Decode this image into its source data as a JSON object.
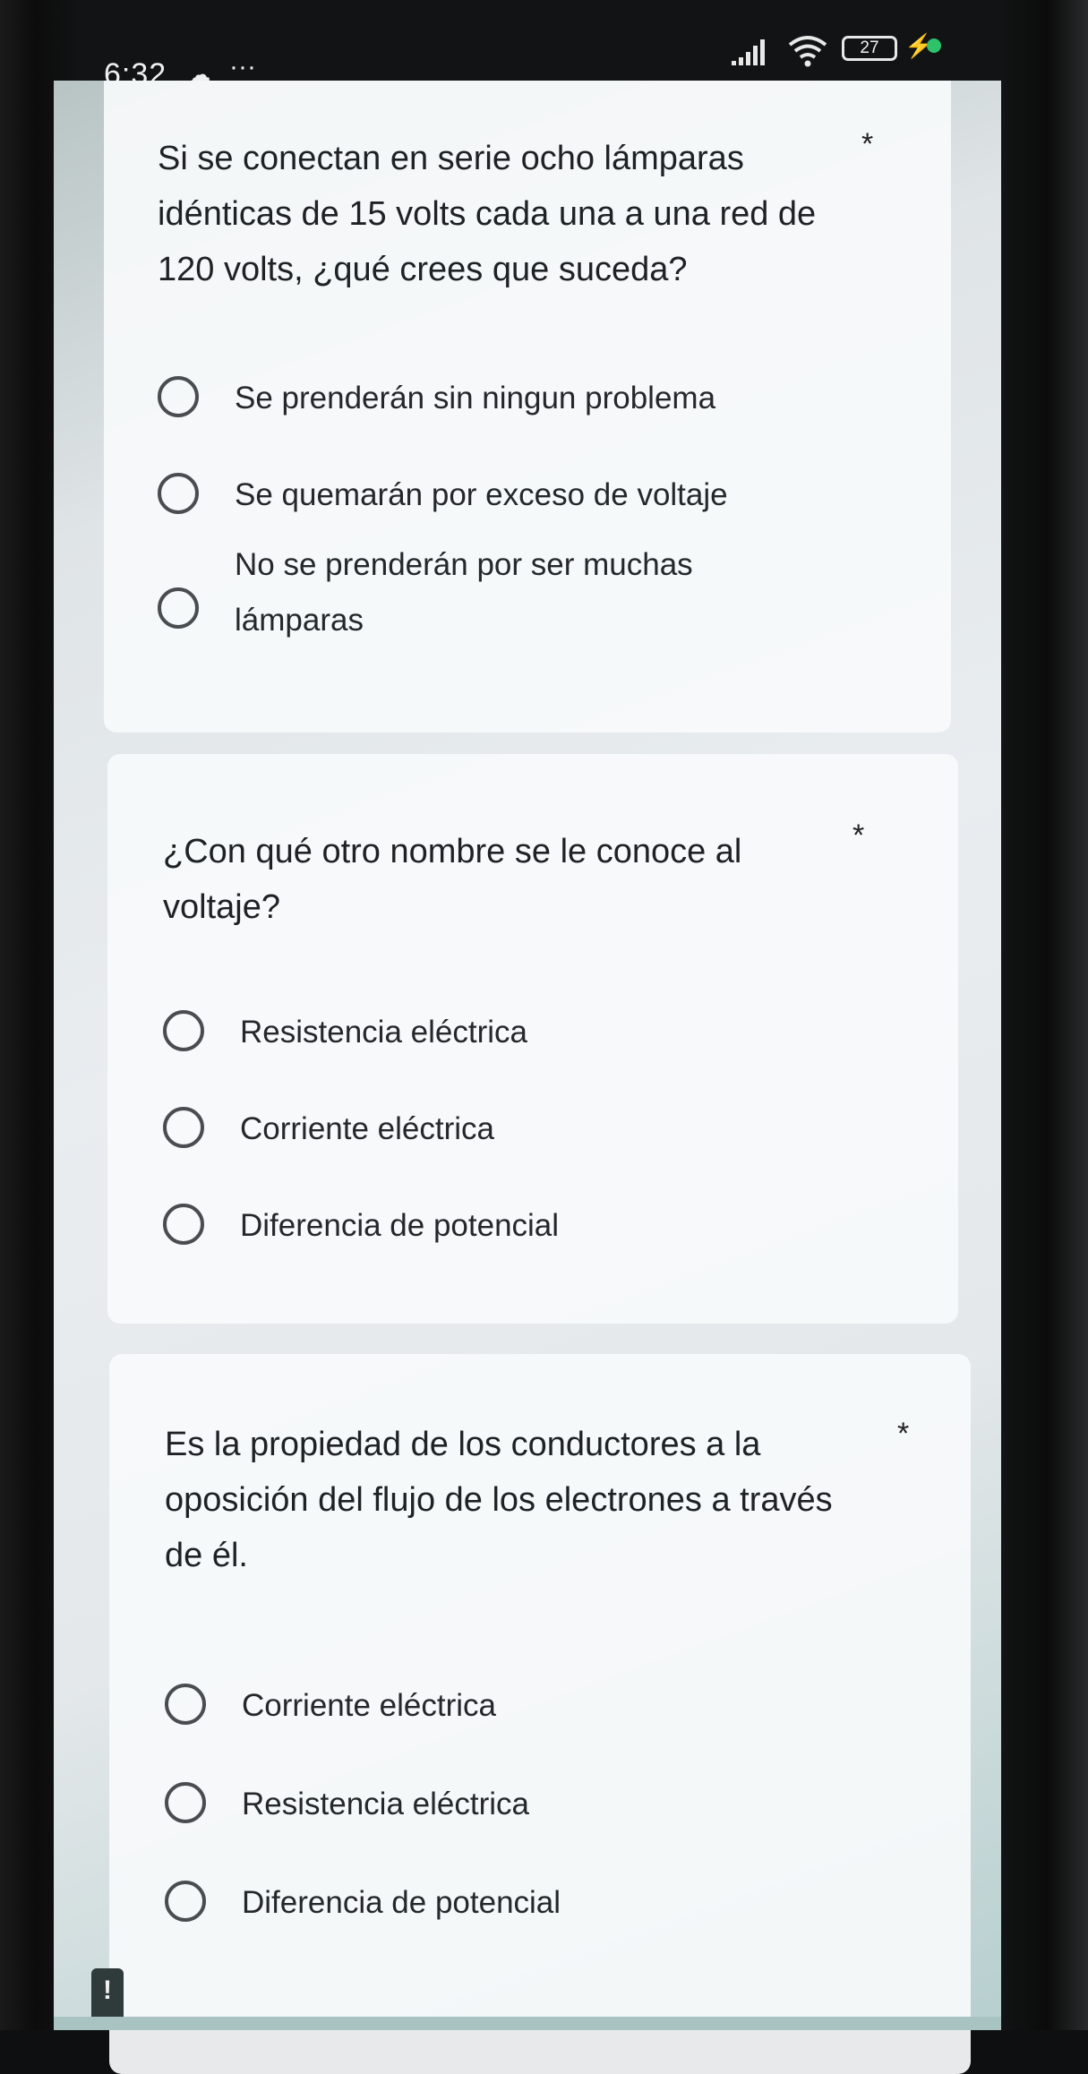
{
  "status_bar": {
    "time": "6:32",
    "cloud_icon": "cloud-icon",
    "more": "···",
    "battery": "27",
    "charging_icon": "bolt-icon",
    "dot_color": "#2ec26b"
  },
  "questions": [
    {
      "text": "Si se conectan en serie ocho lámparas idénticas de 15 volts cada una a una red de 120 volts, ¿qué crees que suceda?",
      "required": "*",
      "options": [
        "Se prenderán sin ningun problema",
        "Se quemarán por exceso de voltaje",
        "No se prenderán por ser muchas lámparas"
      ]
    },
    {
      "text": "¿Con qué otro nombre se le conoce al voltaje?",
      "required": "*",
      "options": [
        "Resistencia eléctrica",
        "Corriente eléctrica",
        "Diferencia de potencial"
      ]
    },
    {
      "text": "Es la propiedad de los conductores a la oposición del flujo de los electrones a través de él.",
      "required": "*",
      "options": [
        "Corriente eléctrica",
        "Resistencia eléctrica",
        "Diferencia de potencial"
      ]
    }
  ],
  "feedback_badge": "!"
}
